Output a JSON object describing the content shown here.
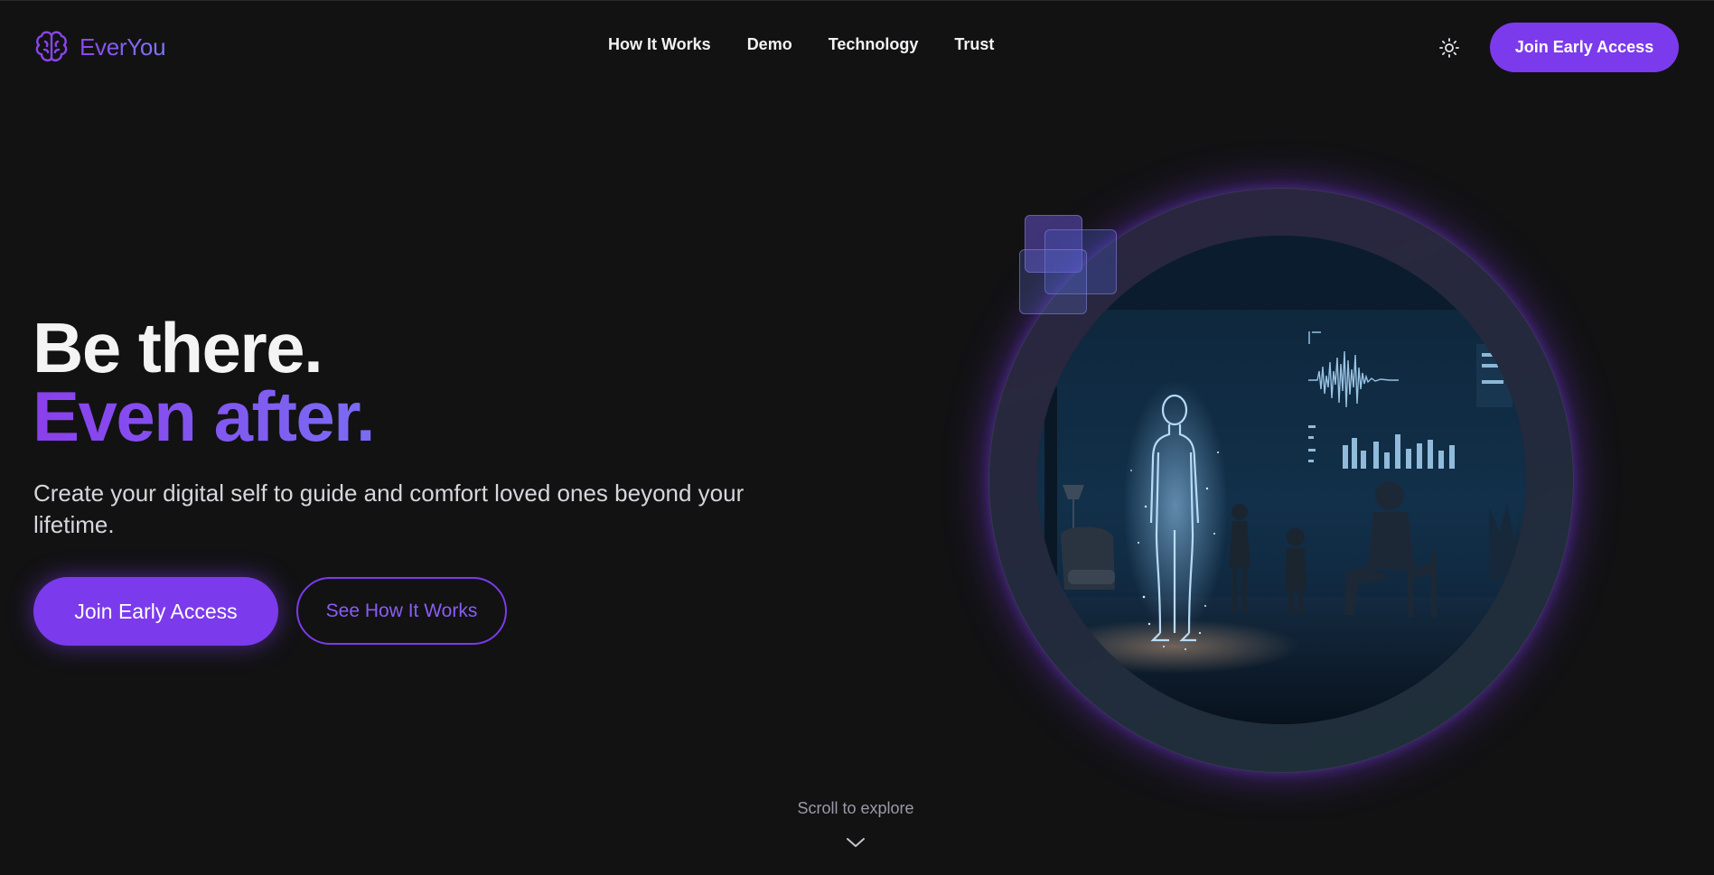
{
  "brand": {
    "name": "EverYou",
    "icon": "brain-icon"
  },
  "nav": {
    "links": [
      {
        "label": "How It Works"
      },
      {
        "label": "Demo"
      },
      {
        "label": "Technology"
      },
      {
        "label": "Trust"
      }
    ],
    "theme_icon": "sun-icon",
    "cta_label": "Join Early Access"
  },
  "hero": {
    "title_line1": "Be there.",
    "title_line2": "Even after.",
    "subtitle": "Create your digital self to guide and comfort loved ones beyond your lifetime.",
    "primary_cta": "Join Early Access",
    "secondary_cta": "See How It Works"
  },
  "scroll": {
    "label": "Scroll to explore",
    "icon": "chevron-down-icon"
  },
  "colors": {
    "background": "#121213",
    "accent": "#7c3aed",
    "accent_light": "#7a6cf3",
    "text_primary": "#f4f4f5",
    "text_secondary": "#d6d6dc"
  }
}
